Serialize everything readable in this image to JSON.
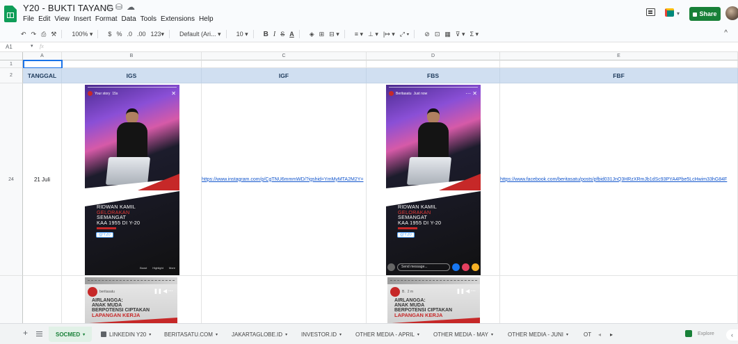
{
  "document": {
    "title": "Y20 - BUKTI TAYANG",
    "star_icon": "star-icon",
    "move_icon": "folder-move-icon",
    "cloud_icon": "cloud-status-icon"
  },
  "menu": [
    "File",
    "Edit",
    "View",
    "Insert",
    "Format",
    "Data",
    "Tools",
    "Extensions",
    "Help"
  ],
  "header_right": {
    "share_label": "Share",
    "brand_color": "#188038"
  },
  "toolbar": {
    "undo": "↶",
    "redo": "↷",
    "print": "⎙",
    "paint": "⚒",
    "zoom": "100% ▾",
    "currency": "$",
    "percent": "%",
    "dec_less": ".0",
    "dec_more": ".00",
    "format_more": "123▾",
    "font": "Default (Ari... ▾",
    "font_size": "10 ▾",
    "bold": "B",
    "italic": "I",
    "strike": "S",
    "text_color": "A",
    "fill": "◈",
    "borders": "⊞",
    "merge": "⊟ ▾",
    "halign": "≡ ▾",
    "valign": "⊥ ▾",
    "wrap": "|↦ ▾",
    "rotate": "⤢ ▾",
    "link": "⊘",
    "comment": "⊡",
    "chart": "▦",
    "filter": "⊽ ▾",
    "functions": "Σ ▾",
    "collapse": "^"
  },
  "formula_bar": {
    "cell_ref": "A1",
    "fx": "fx",
    "value": ""
  },
  "columns": [
    "A",
    "B",
    "C",
    "D",
    "E"
  ],
  "rows": [
    "1",
    "2",
    "24"
  ],
  "headers": {
    "tanggal": "TANGGAL",
    "igs": "IGS",
    "igf": "IGF",
    "fbs": "FBS",
    "fbf": "FBF"
  },
  "row24": {
    "date": "21 Juli",
    "igf_link": "https://www.instagram.com/p/CgTNU6mmmWD/?igshid=YmMyMTA2M2Y=",
    "fbf_link": "https://www.facebook.com/beritasatu/posts/pfbid031JnQ3HRzXRmJb1dSc93PYA4Pbe5LcHwim33hG84F"
  },
  "story1": {
    "account": "Your story",
    "time": "15s",
    "caption_line1": "RIDWAN KAMIL",
    "caption_line2": "GELORAKAN",
    "caption_line3": "SEMANGAT",
    "caption_line4": "KAA 1955 DI Y-20",
    "tag": "@Y20",
    "footer": [
      "Boost",
      "Highlight",
      "More"
    ]
  },
  "story2": {
    "account": "Beritasatu",
    "time": "Just now",
    "caption_line1": "RIDWAN KAMIL",
    "caption_line2": "GELORAKAN",
    "caption_line3": "SEMANGAT",
    "caption_line4": "KAA 1955 DI Y-20",
    "tag": "@Y20",
    "message_placeholder": "Send message..."
  },
  "story3": {
    "account": "beritasatu",
    "title_line1": "AIRLANGGA:",
    "title_line2": "ANAK MUDA",
    "title_line3": "BERPOTENSI CIPTAKAN",
    "title_line4": "LAPANGAN KERJA"
  },
  "story4": {
    "account": "B.",
    "time": "2 m",
    "title_line1": "AIRLANGGA:",
    "title_line2": "ANAK MUDA",
    "title_line3": "BERPOTENSI CIPTAKAN",
    "title_line4": "LAPANGAN KERJA"
  },
  "sheet_tabs": [
    "SOCMED",
    "LINKEDIN Y20",
    "BERITASATU.COM",
    "JAKARTAGLOBE.ID",
    "INVESTOR.ID",
    "OTHER MEDIA - APRIL",
    "OTHER MEDIA - MAY",
    "OTHER MEDIA - JUNI",
    "OT"
  ],
  "explore_label": "Explore",
  "colors": {
    "header_fill": "#d0dff1",
    "link": "#1155cc",
    "selection": "#1a73e8"
  }
}
